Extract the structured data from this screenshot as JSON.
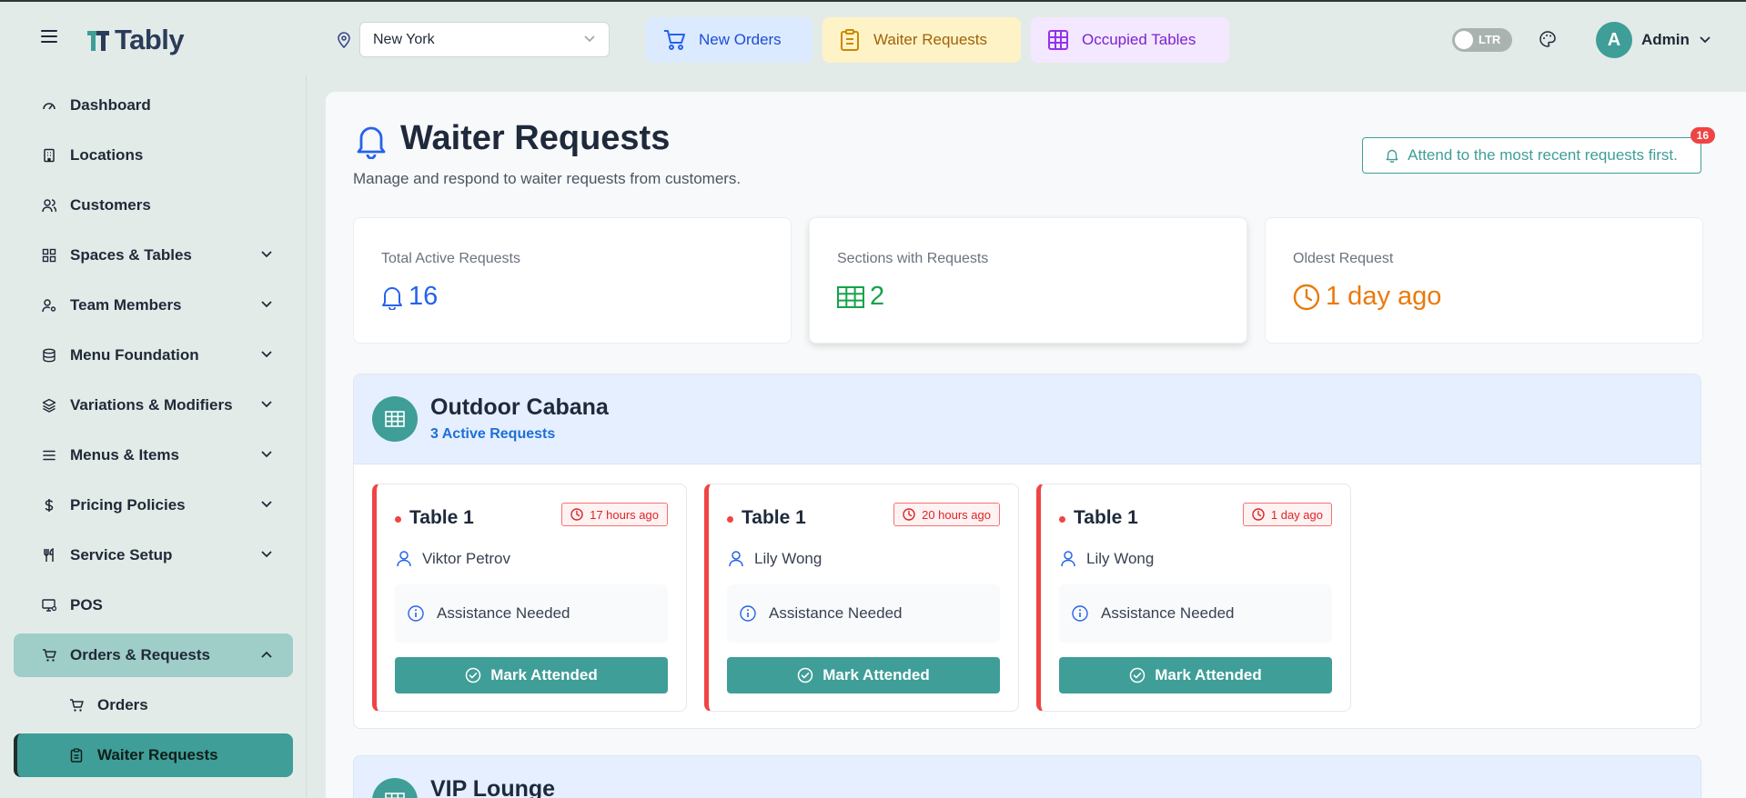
{
  "app": {
    "name": "Tably"
  },
  "header": {
    "location": "New York",
    "quick": [
      {
        "label": "New Orders"
      },
      {
        "label": "Waiter Requests"
      },
      {
        "label": "Occupied Tables"
      }
    ],
    "direction_toggle": "LTR",
    "user": {
      "initial": "A",
      "name": "Admin"
    }
  },
  "sidebar": {
    "items": [
      {
        "label": "Dashboard",
        "icon": "gauge-icon"
      },
      {
        "label": "Locations",
        "icon": "building-icon"
      },
      {
        "label": "Customers",
        "icon": "users-icon"
      },
      {
        "label": "Spaces & Tables",
        "icon": "grid-icon",
        "expandable": true
      },
      {
        "label": "Team Members",
        "icon": "user-cog-icon",
        "expandable": true
      },
      {
        "label": "Menu Foundation",
        "icon": "database-icon",
        "expandable": true
      },
      {
        "label": "Variations & Modifiers",
        "icon": "layers-icon",
        "expandable": true
      },
      {
        "label": "Menus & Items",
        "icon": "list-icon",
        "expandable": true
      },
      {
        "label": "Pricing Policies",
        "icon": "dollar-icon",
        "expandable": true
      },
      {
        "label": "Service Setup",
        "icon": "utensils-icon",
        "expandable": true
      },
      {
        "label": "POS",
        "icon": "monitor-icon"
      },
      {
        "label": "Orders & Requests",
        "icon": "cart-icon",
        "expanded": true
      }
    ],
    "sub_items": [
      {
        "label": "Orders",
        "icon": "cart-icon"
      },
      {
        "label": "Waiter Requests",
        "icon": "clipboard-icon",
        "active": true
      }
    ]
  },
  "page": {
    "title": "Waiter Requests",
    "subtitle": "Manage and respond to waiter requests from customers.",
    "tip": "Attend to the most recent requests first.",
    "tip_badge": "16"
  },
  "stats": [
    {
      "label": "Total Active Requests",
      "value": "16",
      "color": "#2563eb"
    },
    {
      "label": "Sections with Requests",
      "value": "2",
      "color": "#16a34a"
    },
    {
      "label": "Oldest Request",
      "value": "1 day ago",
      "color": "#ea7a0c"
    }
  ],
  "sections": [
    {
      "name": "Outdoor Cabana",
      "count": "3 Active Requests",
      "requests": [
        {
          "table": "Table 1",
          "time": "17 hours ago",
          "customer": "Viktor Petrov",
          "message": "Assistance Needed",
          "action": "Mark Attended"
        },
        {
          "table": "Table 1",
          "time": "20 hours ago",
          "customer": "Lily Wong",
          "message": "Assistance Needed",
          "action": "Mark Attended"
        },
        {
          "table": "Table 1",
          "time": "1 day ago",
          "customer": "Lily Wong",
          "message": "Assistance Needed",
          "action": "Mark Attended"
        }
      ]
    },
    {
      "name": "VIP Lounge"
    }
  ]
}
